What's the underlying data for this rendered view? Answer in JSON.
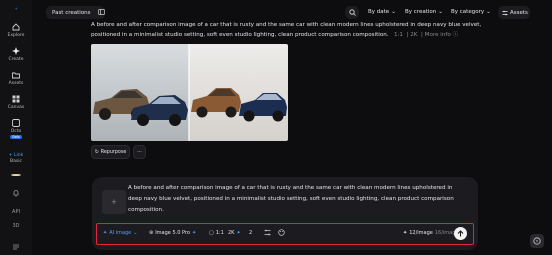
{
  "sidebar": {
    "items": [
      {
        "label": "Explore",
        "icon": "home-icon"
      },
      {
        "label": "Create",
        "icon": "sparkle-icon"
      },
      {
        "label": "Assets",
        "icon": "folder-icon"
      },
      {
        "label": "Canvas",
        "icon": "grid-icon"
      },
      {
        "label": "Octo",
        "icon": "octo-icon",
        "badge": "Beta"
      }
    ],
    "link_label": "+ Link",
    "link_sub": "Basic",
    "bottom": [
      "API",
      "3D"
    ]
  },
  "topbar": {
    "past_creations": "Past creations",
    "by_date": "By date",
    "by_creation": "By creation",
    "by_category": "By category",
    "assets": "Assets"
  },
  "result": {
    "prompt": "A before and after comparison image of a car that is rusty and the same car with clean modern lines upholstered in deep navy blue velvet, positioned in a minimalist studio setting, soft even studio lighting, clean product comparison composition.",
    "ratio": "1:1",
    "resolution": "2K",
    "more_info": "More info",
    "repurpose": "Repurpose",
    "more_label": "···"
  },
  "composer": {
    "prompt": "A before and after comparison image of a car that is rusty and the same car with clean modern lines upholstered in deep navy blue velvet, positioned in a minimalist studio setting, soft even studio lighting, clean product comparison composition.",
    "mode": "AI image",
    "model": "Image 5.0 Pro",
    "ratio": "1:1",
    "resolution": "2K",
    "count": "2",
    "credits": "12/image",
    "credits_suffix": "16/image"
  },
  "colors": {
    "accent": "#4ea1ff",
    "highlight_border": "#e0243a",
    "background": "#0d0d0f",
    "panel": "#1c1c20"
  }
}
